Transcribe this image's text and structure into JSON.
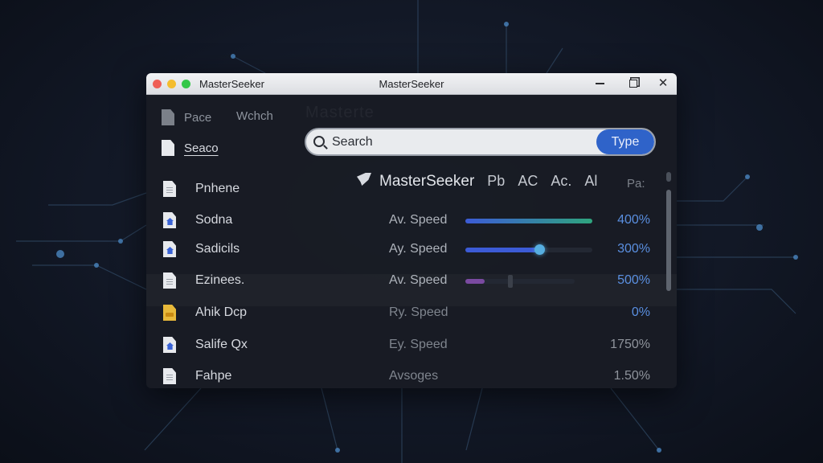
{
  "window": {
    "app_name": "MasterSeeker",
    "title": "MasterSeeker"
  },
  "watermark": "Masterte",
  "sidebar": {
    "tabs": [
      {
        "label": "Pace",
        "icon": "document-icon"
      },
      {
        "label": "Wchch"
      }
    ],
    "selected": {
      "label": "Seaco",
      "icon": "document-icon"
    }
  },
  "search": {
    "placeholder": "Search",
    "type_button": "Type"
  },
  "results_header": {
    "brand": "MasterSeeker",
    "columns": [
      "Pb",
      "AC",
      "Ac.",
      "Al"
    ],
    "extra": "Pa:"
  },
  "rows": [
    {
      "name": "Pnhene",
      "icon": "document-icon",
      "metric": "",
      "value": "",
      "percent": null
    },
    {
      "name": "Sodna",
      "icon": "image-document-icon",
      "metric": "Av. Speed",
      "value": "400%",
      "percent": 100
    },
    {
      "name": "Sadicils",
      "icon": "image-document-icon",
      "metric": "Ay. Speed",
      "value": "300%",
      "percent": 58
    },
    {
      "name": "Ezinees.",
      "icon": "document-icon",
      "metric": "Av. Speed",
      "value": "500%",
      "percent": 18
    },
    {
      "name": "Ahik Dcp",
      "icon": "archive-document-icon",
      "metric": "Ry. Speed",
      "value": "0%",
      "percent": null
    },
    {
      "name": "Salife Qx",
      "icon": "image-document-icon",
      "metric": "Ey. Speed",
      "value": "1750%",
      "percent": null
    },
    {
      "name": "Fahpe",
      "icon": "document-icon",
      "metric": "Avsoges",
      "value": "1.50%",
      "percent": null
    }
  ],
  "colors": {
    "accent": "#2f63c9",
    "bar_green": "#2fa57e",
    "bar_blue": "#3c5bd6",
    "bar_purple": "#7a4aa0",
    "knob": "#56aee0",
    "percent_blue": "#5a8fe0"
  }
}
